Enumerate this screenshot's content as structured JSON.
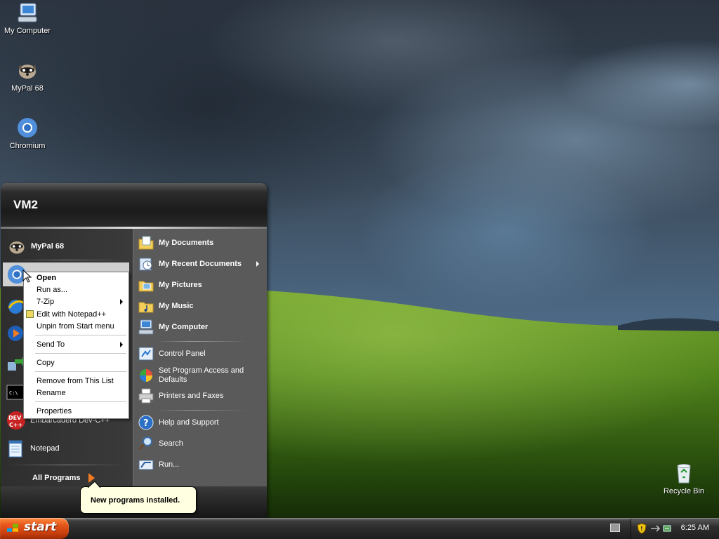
{
  "desktop": {
    "icons": [
      {
        "label": "My Computer",
        "icon": "computer-icon"
      },
      {
        "label": "MyPal 68",
        "icon": "mypal-icon"
      },
      {
        "label": "Chromium",
        "icon": "chromium-icon"
      },
      {
        "label": "Recycle Bin",
        "icon": "recycle-bin-icon"
      }
    ]
  },
  "start_menu": {
    "user_name": "VM2",
    "pinned": [
      {
        "label": "MyPal 68",
        "icon": "mypal-icon"
      }
    ],
    "recent": [
      {
        "label": "Embarcadero Dev-C++",
        "icon": "devcpp-icon"
      },
      {
        "label": "Notepad",
        "icon": "notepad-icon"
      }
    ],
    "all_programs_label": "All Programs",
    "right_column": [
      {
        "label": "My Documents",
        "icon": "my-documents-icon",
        "bold": true
      },
      {
        "label": "My Recent Documents",
        "icon": "recent-documents-icon",
        "bold": true,
        "submenu": true
      },
      {
        "label": "My Pictures",
        "icon": "my-pictures-icon",
        "bold": true
      },
      {
        "label": "My Music",
        "icon": "my-music-icon",
        "bold": true
      },
      {
        "label": "My Computer",
        "icon": "computer-icon",
        "bold": true
      },
      {
        "label": "Control Panel",
        "icon": "control-panel-icon"
      },
      {
        "label": "Set Program Access and Defaults",
        "icon": "program-defaults-icon"
      },
      {
        "label": "Printers and Faxes",
        "icon": "printer-icon"
      },
      {
        "label": "Help and Support",
        "icon": "help-icon"
      },
      {
        "label": "Search",
        "icon": "search-icon"
      },
      {
        "label": "Run...",
        "icon": "run-icon"
      }
    ]
  },
  "context_menu": {
    "items": [
      {
        "label": "Open",
        "bold": true
      },
      {
        "label": "Run as..."
      },
      {
        "label": "7-Zip",
        "submenu": true
      },
      {
        "label": "Edit with Notepad++",
        "icon": "notepadpp-icon"
      },
      {
        "label": "Unpin from Start menu"
      },
      {
        "label": "Send To",
        "submenu": true
      },
      {
        "label": "Copy"
      },
      {
        "label": "Remove from This List"
      },
      {
        "label": "Rename"
      },
      {
        "label": "Properties"
      }
    ]
  },
  "balloon": {
    "text": "New programs installed."
  },
  "taskbar": {
    "start_label": "start",
    "clock": "6:25 AM"
  },
  "colors": {
    "start_orange": "#e4561a",
    "menu_dark": "#3a3a3a",
    "menu_right": "#5a5a5a",
    "balloon_bg": "#ffffe1"
  }
}
